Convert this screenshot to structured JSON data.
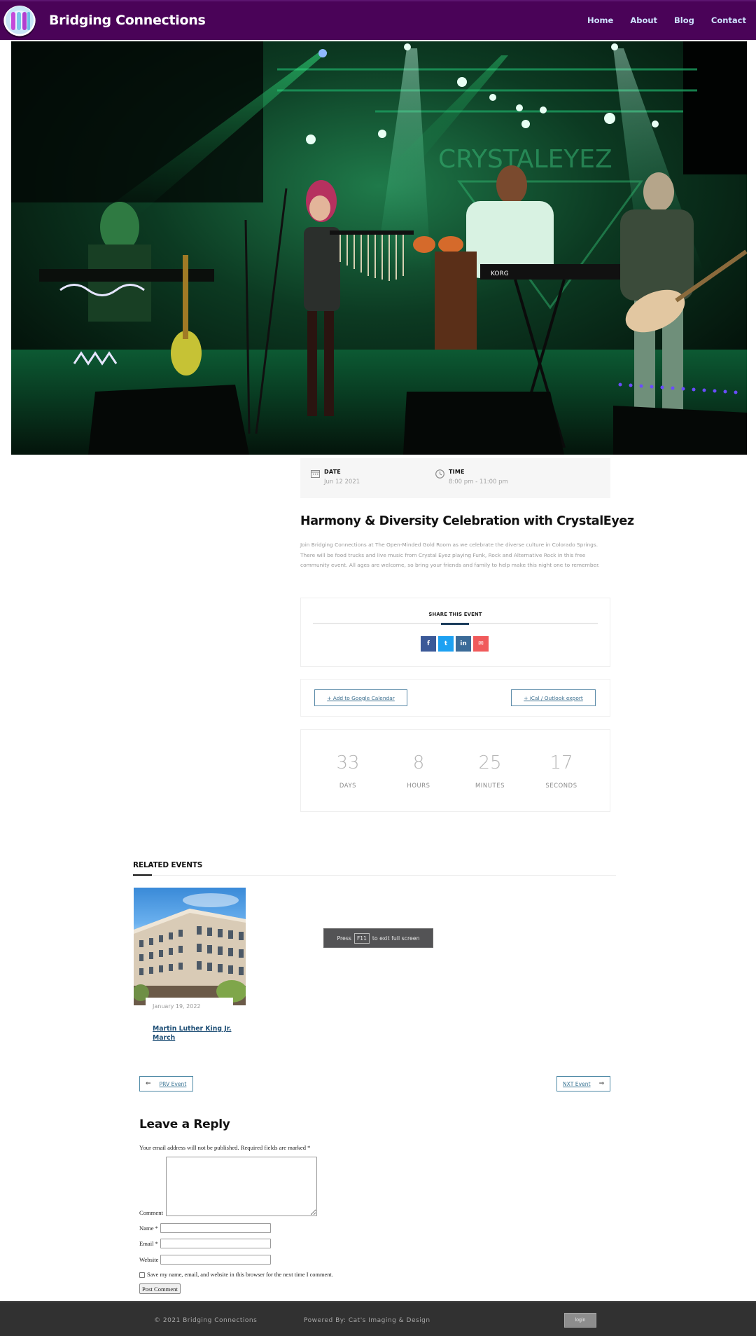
{
  "header": {
    "site_title": "Bridging Connections",
    "nav": [
      {
        "label": "Home"
      },
      {
        "label": "About"
      },
      {
        "label": "Blog"
      },
      {
        "label": "Contact"
      }
    ]
  },
  "hero": {
    "alt": "Band CrystalEyez performing on stage under green lights",
    "backdrop_text": "CRYSTALEYEZ"
  },
  "event": {
    "date_label": "DATE",
    "date_value": "Jun 12 2021",
    "time_label": "TIME",
    "time_value": "8:00 pm - 11:00 pm",
    "title": "Harmony & Diversity Celebration with CrystalEyez",
    "description": "Join Bridging Connections at The Open-Minded Gold Room as we celebrate the diverse culture in Colorado Springs. There will be food trucks and live music from Crystal Eyez playing Funk, Rock and Alternative Rock in this free community event. All ages are welcome, so bring your friends and family to help make this night one to remember."
  },
  "share": {
    "title": "SHARE THIS EVENT",
    "buttons": [
      {
        "name": "facebook",
        "glyph": "f",
        "color": "#3b5998"
      },
      {
        "name": "twitter",
        "glyph": "t",
        "color": "#1da1f2"
      },
      {
        "name": "linkedin",
        "glyph": "in",
        "color": "#3b6b98"
      },
      {
        "name": "email",
        "glyph": "✉",
        "color": "#f05a5b"
      }
    ]
  },
  "calendar": {
    "google_label": "+ Add to Google Calendar",
    "ical_label": "+ iCal / Outlook export"
  },
  "countdown": [
    {
      "value": "33",
      "label": "DAYS"
    },
    {
      "value": "8",
      "label": "HOURS"
    },
    {
      "value": "25",
      "label": "MINUTES"
    },
    {
      "value": "17",
      "label": "SECONDS"
    }
  ],
  "related": {
    "title": "RELATED EVENTS",
    "items": [
      {
        "date": "January 19, 2022",
        "title": "Martin Luther King Jr. March"
      }
    ]
  },
  "toast": {
    "before": "Press",
    "key": "F11",
    "after": "to exit full screen"
  },
  "pagination": {
    "prev_label": "PRV Event",
    "prev_arrow": "⇐",
    "next_label": "NXT Event",
    "next_arrow": "⇒"
  },
  "reply": {
    "title": "Leave a Reply",
    "note": "Your email address will not be published. Required fields are marked *",
    "comment_label": "Comment",
    "name_label": "Name *",
    "email_label": "Email *",
    "website_label": "Website",
    "name_value": "",
    "email_value": "",
    "website_value": "",
    "cookie_label": "Save my name, email, and website in this browser for the next time I comment.",
    "submit_label": "Post Comment"
  },
  "footer": {
    "copyright": "© 2021 Bridging Connections",
    "powered_by": "Powered By: Cat's Imaging & Design",
    "login_label": "login"
  }
}
